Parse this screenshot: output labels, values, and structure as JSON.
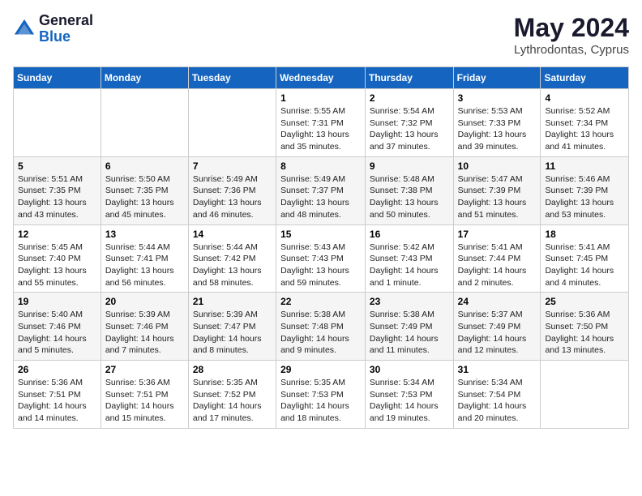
{
  "header": {
    "logo_general": "General",
    "logo_blue": "Blue",
    "month_year": "May 2024",
    "location": "Lythrodontas, Cyprus"
  },
  "weekdays": [
    "Sunday",
    "Monday",
    "Tuesday",
    "Wednesday",
    "Thursday",
    "Friday",
    "Saturday"
  ],
  "weeks": [
    [
      {
        "day": "",
        "sunrise": "",
        "sunset": "",
        "daylight": ""
      },
      {
        "day": "",
        "sunrise": "",
        "sunset": "",
        "daylight": ""
      },
      {
        "day": "",
        "sunrise": "",
        "sunset": "",
        "daylight": ""
      },
      {
        "day": "1",
        "sunrise": "Sunrise: 5:55 AM",
        "sunset": "Sunset: 7:31 PM",
        "daylight": "Daylight: 13 hours and 35 minutes."
      },
      {
        "day": "2",
        "sunrise": "Sunrise: 5:54 AM",
        "sunset": "Sunset: 7:32 PM",
        "daylight": "Daylight: 13 hours and 37 minutes."
      },
      {
        "day": "3",
        "sunrise": "Sunrise: 5:53 AM",
        "sunset": "Sunset: 7:33 PM",
        "daylight": "Daylight: 13 hours and 39 minutes."
      },
      {
        "day": "4",
        "sunrise": "Sunrise: 5:52 AM",
        "sunset": "Sunset: 7:34 PM",
        "daylight": "Daylight: 13 hours and 41 minutes."
      }
    ],
    [
      {
        "day": "5",
        "sunrise": "Sunrise: 5:51 AM",
        "sunset": "Sunset: 7:35 PM",
        "daylight": "Daylight: 13 hours and 43 minutes."
      },
      {
        "day": "6",
        "sunrise": "Sunrise: 5:50 AM",
        "sunset": "Sunset: 7:35 PM",
        "daylight": "Daylight: 13 hours and 45 minutes."
      },
      {
        "day": "7",
        "sunrise": "Sunrise: 5:49 AM",
        "sunset": "Sunset: 7:36 PM",
        "daylight": "Daylight: 13 hours and 46 minutes."
      },
      {
        "day": "8",
        "sunrise": "Sunrise: 5:49 AM",
        "sunset": "Sunset: 7:37 PM",
        "daylight": "Daylight: 13 hours and 48 minutes."
      },
      {
        "day": "9",
        "sunrise": "Sunrise: 5:48 AM",
        "sunset": "Sunset: 7:38 PM",
        "daylight": "Daylight: 13 hours and 50 minutes."
      },
      {
        "day": "10",
        "sunrise": "Sunrise: 5:47 AM",
        "sunset": "Sunset: 7:39 PM",
        "daylight": "Daylight: 13 hours and 51 minutes."
      },
      {
        "day": "11",
        "sunrise": "Sunrise: 5:46 AM",
        "sunset": "Sunset: 7:39 PM",
        "daylight": "Daylight: 13 hours and 53 minutes."
      }
    ],
    [
      {
        "day": "12",
        "sunrise": "Sunrise: 5:45 AM",
        "sunset": "Sunset: 7:40 PM",
        "daylight": "Daylight: 13 hours and 55 minutes."
      },
      {
        "day": "13",
        "sunrise": "Sunrise: 5:44 AM",
        "sunset": "Sunset: 7:41 PM",
        "daylight": "Daylight: 13 hours and 56 minutes."
      },
      {
        "day": "14",
        "sunrise": "Sunrise: 5:44 AM",
        "sunset": "Sunset: 7:42 PM",
        "daylight": "Daylight: 13 hours and 58 minutes."
      },
      {
        "day": "15",
        "sunrise": "Sunrise: 5:43 AM",
        "sunset": "Sunset: 7:43 PM",
        "daylight": "Daylight: 13 hours and 59 minutes."
      },
      {
        "day": "16",
        "sunrise": "Sunrise: 5:42 AM",
        "sunset": "Sunset: 7:43 PM",
        "daylight": "Daylight: 14 hours and 1 minute."
      },
      {
        "day": "17",
        "sunrise": "Sunrise: 5:41 AM",
        "sunset": "Sunset: 7:44 PM",
        "daylight": "Daylight: 14 hours and 2 minutes."
      },
      {
        "day": "18",
        "sunrise": "Sunrise: 5:41 AM",
        "sunset": "Sunset: 7:45 PM",
        "daylight": "Daylight: 14 hours and 4 minutes."
      }
    ],
    [
      {
        "day": "19",
        "sunrise": "Sunrise: 5:40 AM",
        "sunset": "Sunset: 7:46 PM",
        "daylight": "Daylight: 14 hours and 5 minutes."
      },
      {
        "day": "20",
        "sunrise": "Sunrise: 5:39 AM",
        "sunset": "Sunset: 7:46 PM",
        "daylight": "Daylight: 14 hours and 7 minutes."
      },
      {
        "day": "21",
        "sunrise": "Sunrise: 5:39 AM",
        "sunset": "Sunset: 7:47 PM",
        "daylight": "Daylight: 14 hours and 8 minutes."
      },
      {
        "day": "22",
        "sunrise": "Sunrise: 5:38 AM",
        "sunset": "Sunset: 7:48 PM",
        "daylight": "Daylight: 14 hours and 9 minutes."
      },
      {
        "day": "23",
        "sunrise": "Sunrise: 5:38 AM",
        "sunset": "Sunset: 7:49 PM",
        "daylight": "Daylight: 14 hours and 11 minutes."
      },
      {
        "day": "24",
        "sunrise": "Sunrise: 5:37 AM",
        "sunset": "Sunset: 7:49 PM",
        "daylight": "Daylight: 14 hours and 12 minutes."
      },
      {
        "day": "25",
        "sunrise": "Sunrise: 5:36 AM",
        "sunset": "Sunset: 7:50 PM",
        "daylight": "Daylight: 14 hours and 13 minutes."
      }
    ],
    [
      {
        "day": "26",
        "sunrise": "Sunrise: 5:36 AM",
        "sunset": "Sunset: 7:51 PM",
        "daylight": "Daylight: 14 hours and 14 minutes."
      },
      {
        "day": "27",
        "sunrise": "Sunrise: 5:36 AM",
        "sunset": "Sunset: 7:51 PM",
        "daylight": "Daylight: 14 hours and 15 minutes."
      },
      {
        "day": "28",
        "sunrise": "Sunrise: 5:35 AM",
        "sunset": "Sunset: 7:52 PM",
        "daylight": "Daylight: 14 hours and 17 minutes."
      },
      {
        "day": "29",
        "sunrise": "Sunrise: 5:35 AM",
        "sunset": "Sunset: 7:53 PM",
        "daylight": "Daylight: 14 hours and 18 minutes."
      },
      {
        "day": "30",
        "sunrise": "Sunrise: 5:34 AM",
        "sunset": "Sunset: 7:53 PM",
        "daylight": "Daylight: 14 hours and 19 minutes."
      },
      {
        "day": "31",
        "sunrise": "Sunrise: 5:34 AM",
        "sunset": "Sunset: 7:54 PM",
        "daylight": "Daylight: 14 hours and 20 minutes."
      },
      {
        "day": "",
        "sunrise": "",
        "sunset": "",
        "daylight": ""
      }
    ]
  ]
}
